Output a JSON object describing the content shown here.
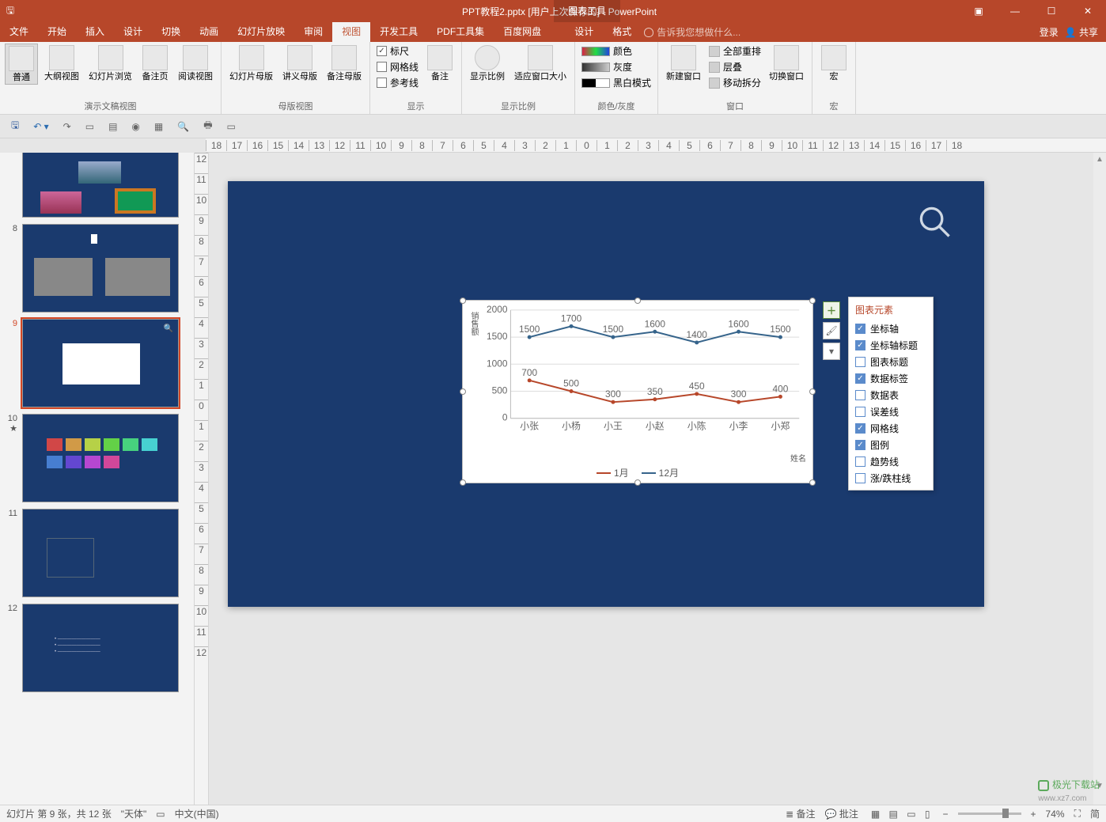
{
  "app": {
    "title": "PPT教程2.pptx [用户上次保存的] - PowerPoint",
    "context_tool": "图表工具",
    "login": "登录",
    "share": "共享"
  },
  "tabs": {
    "file": "文件",
    "home": "开始",
    "insert": "插入",
    "design": "设计",
    "transitions": "切换",
    "animations": "动画",
    "slideshow": "幻灯片放映",
    "review": "审阅",
    "view": "视图",
    "developer": "开发工具",
    "pdf": "PDF工具集",
    "baidu": "百度网盘",
    "ctx_design": "设计",
    "ctx_format": "格式",
    "tellme": "告诉我您想做什么..."
  },
  "ribbon": {
    "g1": {
      "normal": "普通",
      "outline": "大纲视图",
      "sorter": "幻灯片浏览",
      "notes": "备注页",
      "reading": "阅读视图",
      "label": "演示文稿视图"
    },
    "g2": {
      "slidemaster": "幻灯片母版",
      "handout": "讲义母版",
      "notesmaster": "备注母版",
      "label": "母版视图"
    },
    "g3": {
      "ruler": "标尺",
      "gridlines": "网格线",
      "guides": "参考线",
      "notes2": "备注",
      "label": "显示"
    },
    "g4": {
      "zoom": "显示比例",
      "fit": "适应窗口大小",
      "label": "显示比例"
    },
    "g5": {
      "color": "颜色",
      "gray": "灰度",
      "bw": "黑白模式",
      "label": "颜色/灰度"
    },
    "g6": {
      "newwin": "新建窗口",
      "arrange": "全部重排",
      "cascade": "层叠",
      "split": "移动拆分",
      "switch": "切换窗口",
      "label": "窗口"
    },
    "g7": {
      "macros": "宏",
      "label": "宏"
    }
  },
  "chart_elements": {
    "title": "图表元素",
    "items": [
      {
        "label": "坐标轴",
        "checked": true
      },
      {
        "label": "坐标轴标题",
        "checked": true
      },
      {
        "label": "图表标题",
        "checked": false
      },
      {
        "label": "数据标签",
        "checked": true
      },
      {
        "label": "数据表",
        "checked": false
      },
      {
        "label": "误差线",
        "checked": false
      },
      {
        "label": "网格线",
        "checked": true
      },
      {
        "label": "图例",
        "checked": true
      },
      {
        "label": "趋势线",
        "checked": false
      },
      {
        "label": "涨/跌柱线",
        "checked": false
      }
    ]
  },
  "chart_data": {
    "type": "line",
    "categories": [
      "小张",
      "小杨",
      "小王",
      "小赵",
      "小陈",
      "小李",
      "小郑"
    ],
    "series": [
      {
        "name": "1月",
        "color": "#b7472a",
        "values": [
          700,
          500,
          300,
          350,
          450,
          300,
          400
        ]
      },
      {
        "name": "12月",
        "color": "#36648b",
        "values": [
          1500,
          1700,
          1500,
          1600,
          1400,
          1600,
          1500
        ]
      }
    ],
    "ylabel": "销售额",
    "xlabel": "姓名",
    "ylim": [
      0,
      2000
    ],
    "yticks": [
      0,
      500,
      1000,
      1500,
      2000
    ]
  },
  "thumbs": [
    {
      "n": 8
    },
    {
      "n": 9,
      "selected": true,
      "chart": true
    },
    {
      "n": 10,
      "star": true
    },
    {
      "n": 11
    },
    {
      "n": 12
    }
  ],
  "ruler_ticks": [
    "18",
    "17",
    "16",
    "15",
    "14",
    "13",
    "12",
    "11",
    "10",
    "9",
    "8",
    "7",
    "6",
    "5",
    "4",
    "3",
    "2",
    "1",
    "0",
    "1",
    "2",
    "3",
    "4",
    "5",
    "6",
    "7",
    "8",
    "9",
    "10",
    "11",
    "12",
    "13",
    "14",
    "15",
    "16",
    "17",
    "18"
  ],
  "vruler_ticks": [
    "12",
    "11",
    "10",
    "9",
    "8",
    "7",
    "6",
    "5",
    "4",
    "3",
    "2",
    "1",
    "0",
    "1",
    "2",
    "3",
    "4",
    "5",
    "6",
    "7",
    "8",
    "9",
    "10",
    "11",
    "12"
  ],
  "status": {
    "slide_info": "幻灯片 第 9 张，共 12 张",
    "theme": "\"天体\"",
    "lang": "中文(中国)",
    "notes_btn": "备注",
    "comments_btn": "批注",
    "zoom": "74%",
    "simp": "简"
  },
  "watermark": "极光下载站"
}
